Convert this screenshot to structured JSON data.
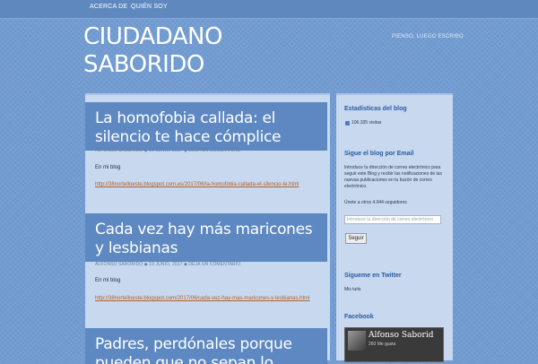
{
  "nav": {
    "items": [
      "ACERCA DE",
      "QUIÉN SOY"
    ]
  },
  "site": {
    "title": "CIUDADANO SABORIDO",
    "tagline": "PIENSO, LUEGO ESCRIBO"
  },
  "posts": [
    {
      "title": "La homofobia callada: el silencio te hace cómplice",
      "author": "ALFONSO SABORIDO",
      "date": "30 JUNIO, 2017",
      "comment": "DEJA UN COMENTARIO",
      "text": "En mi blog",
      "link": "http://38nortelloeste.blogspot.com.es/2017/06/la-homofobia-callada-el-silencio-te.html"
    },
    {
      "title": "Cada vez hay más maricones y lesbianas",
      "author": "ALFONSO SABORIDO",
      "date": "19 JUNIO, 2017",
      "comment": "DEJA UN COMENTARIO",
      "text": "En mi blog",
      "link": "http://38nortelloeste.blogspot.com/2017/06/cada-vez-hay-mas-maricones-y-lesbianas.html"
    },
    {
      "title": "Padres, perdónales porque pueden que no sepan lo",
      "author": "",
      "date": "",
      "comment": "",
      "text": "",
      "link": ""
    }
  ],
  "sidebar": {
    "stats_title": "Estadísticas del blog",
    "stats_visits": "106.335 visitas",
    "email_title": "Sigue el blog por Email",
    "email_desc": "Introduce tu dirección de correo electrónico para seguir este Blog y recibir las notificaciones de las nuevas publicaciones en tu buzón de correo electrónico.",
    "followers": "Únete a otros 4.944 seguidores",
    "email_placeholder": "Introduce tu dirección de correo electrónico",
    "submit_label": "Seguir",
    "twitter_title": "Sígueme en Twitter",
    "twitter_link": "Mis tuits",
    "facebook_title": "Facebook",
    "fb_name": "Alfonso Saborid",
    "fb_likes": "260 Me gusta"
  },
  "colors": {
    "background": "#6f99cf",
    "title_box": "#5d88c2",
    "panel": "#c7d8ef",
    "link": "#b0632a",
    "widget_heading": "#2b5aa3"
  }
}
